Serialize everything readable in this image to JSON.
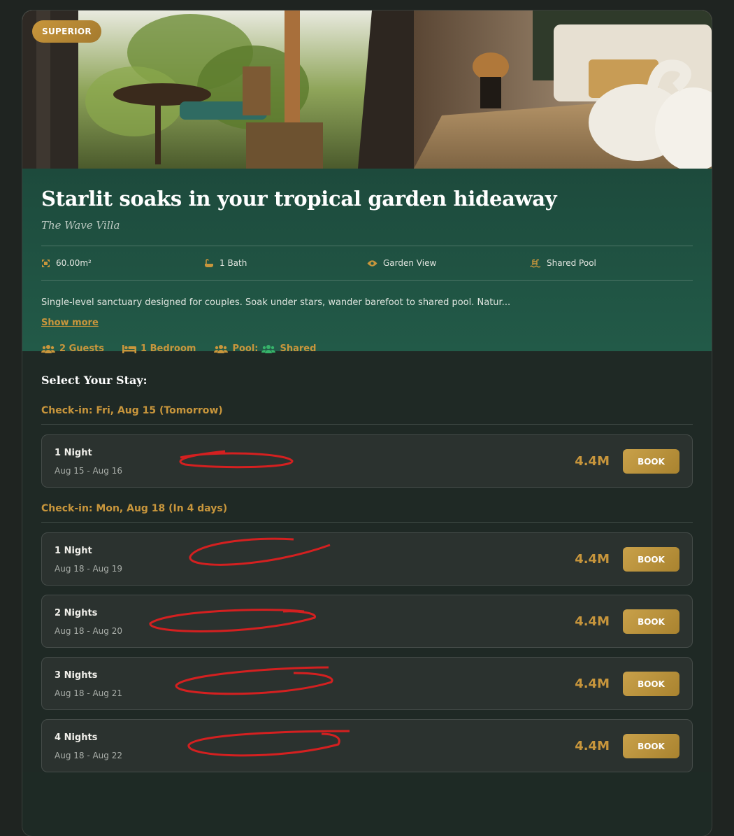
{
  "listing": {
    "badge": "SUPERIOR",
    "title": "Starlit soaks in your tropical garden hideaway",
    "villa": "The Wave Villa",
    "amenities": [
      {
        "icon": "area-icon",
        "label": "60.00m²"
      },
      {
        "icon": "bathtub-icon",
        "label": "1 Bath"
      },
      {
        "icon": "eye-icon",
        "label": "Garden View"
      },
      {
        "icon": "pool-icon",
        "label": "Shared Pool"
      }
    ],
    "description": "Single-level sanctuary designed for couples. Soak under stars, wander barefoot to shared pool. Natur...",
    "show_more": "Show more",
    "features": {
      "guests": "2 Guests",
      "bedrooms": "1 Bedroom",
      "pool_label": "Pool:",
      "pool_value": "Shared"
    },
    "colors": {
      "accent": "#c8963c",
      "panel": "#1d4a3c",
      "shared": "#36b36a"
    }
  },
  "stays": {
    "heading": "Select Your Stay:",
    "groups": [
      {
        "checkin": "Check-in: Fri, Aug 15 (Tomorrow)",
        "options": [
          {
            "nights": "1 Night",
            "dates": "Aug 15 - Aug 16",
            "price": "4.4M",
            "book": "BOOK"
          }
        ]
      },
      {
        "checkin": "Check-in: Mon, Aug 18 (In 4 days)",
        "options": [
          {
            "nights": "1 Night",
            "dates": "Aug 18 - Aug 19",
            "price": "4.4M",
            "book": "BOOK"
          },
          {
            "nights": "2 Nights",
            "dates": "Aug 18 - Aug 20",
            "price": "4.4M",
            "book": "BOOK"
          },
          {
            "nights": "3 Nights",
            "dates": "Aug 18 - Aug 21",
            "price": "4.4M",
            "book": "BOOK"
          },
          {
            "nights": "4 Nights",
            "dates": "Aug 18 - Aug 22",
            "price": "4.4M",
            "book": "BOOK"
          }
        ]
      }
    ]
  }
}
